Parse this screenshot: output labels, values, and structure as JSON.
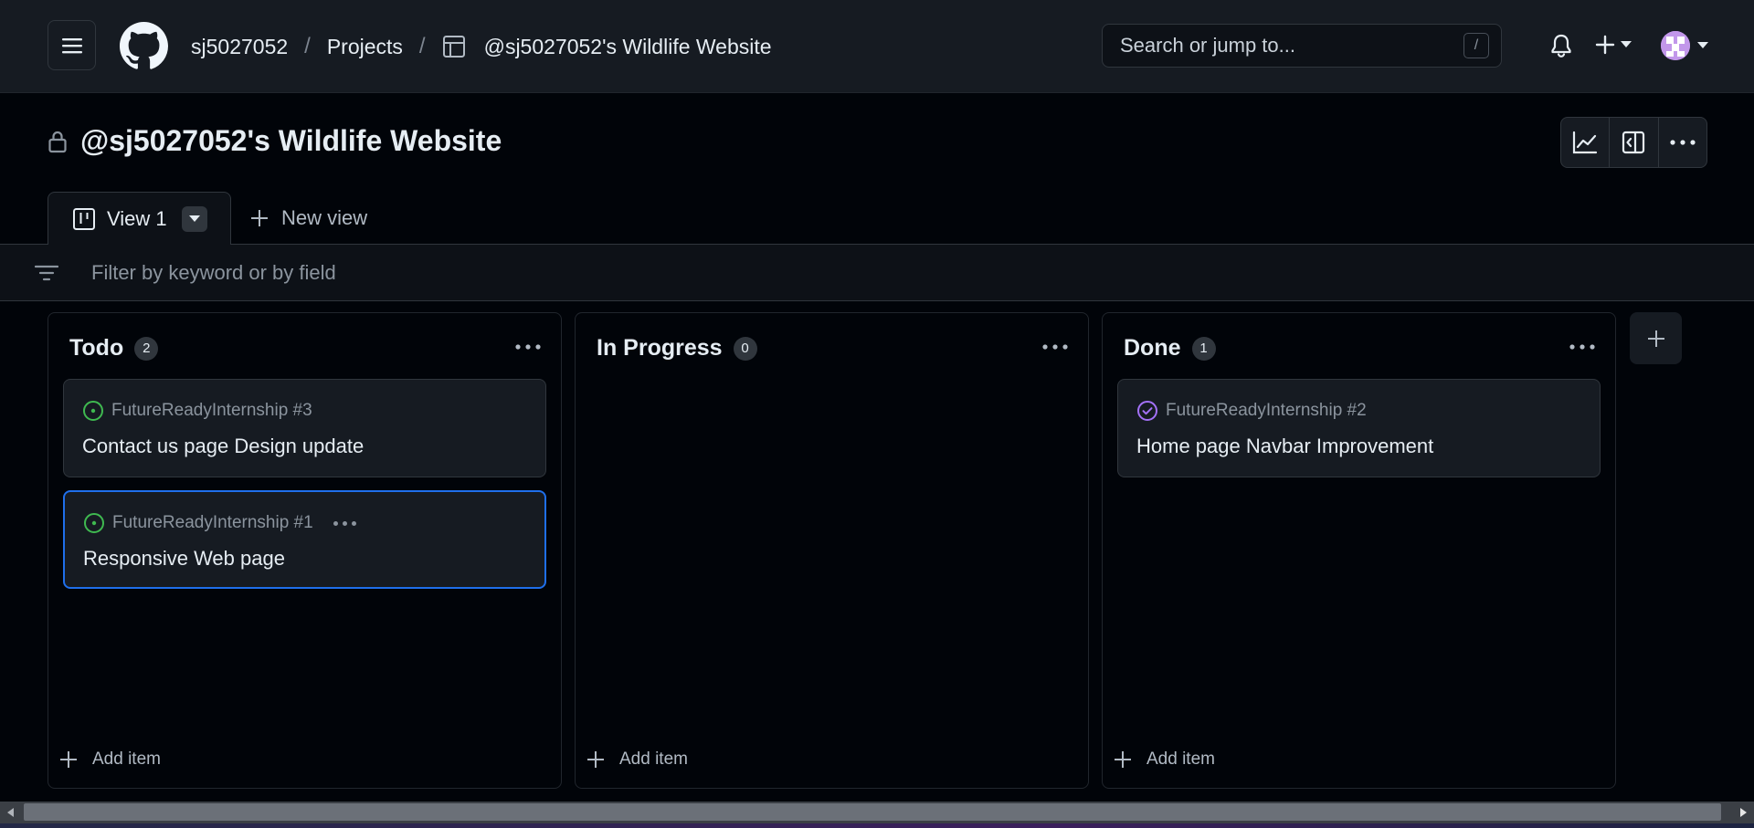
{
  "header": {
    "breadcrumbs": {
      "owner": "sj5027052",
      "separator": "/",
      "projects": "Projects",
      "project": "@sj5027052's Wildlife Website"
    },
    "search": {
      "placeholder": "Search or jump to...",
      "shortcut": "/"
    },
    "icons": [
      "hamburger-icon",
      "github-logo",
      "table-icon",
      "bell-icon",
      "plus-icon",
      "caret-down-icon",
      "avatar"
    ]
  },
  "project": {
    "title": "@sj5027052's Wildlife Website",
    "visibility_icon": "lock-icon",
    "actions": [
      "insights-icon",
      "sidebar-panel-icon",
      "kebab-icon"
    ]
  },
  "views": {
    "active": {
      "label": "View 1",
      "icon": "board-icon"
    },
    "new_view": "New view"
  },
  "filter": {
    "placeholder": "Filter by keyword or by field"
  },
  "board": {
    "columns": [
      {
        "name": "Todo",
        "count": "2",
        "add_item": "Add item",
        "cards": [
          {
            "repo": "FutureReadyInternship #3",
            "title": "Contact us page Design update",
            "status": "open",
            "status_color": "#3fb950"
          },
          {
            "repo": "FutureReadyInternship #1",
            "title": "Responsive Web page",
            "status": "open",
            "status_color": "#3fb950",
            "selected": true
          }
        ]
      },
      {
        "name": "In Progress",
        "count": "0",
        "add_item": "Add item",
        "cards": []
      },
      {
        "name": "Done",
        "count": "1",
        "add_item": "Add item",
        "cards": [
          {
            "repo": "FutureReadyInternship #2",
            "title": "Home page Navbar Improvement",
            "status": "closed",
            "status_color": "#a371f7"
          }
        ]
      }
    ]
  },
  "colors": {
    "background": "#010409",
    "header_bg": "#161b22",
    "accent_selected": "#1f6feb",
    "open_green": "#3fb950",
    "done_purple": "#a371f7"
  }
}
